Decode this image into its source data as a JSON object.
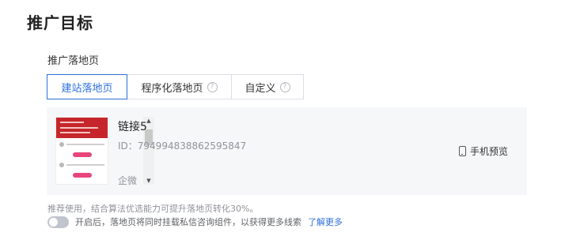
{
  "section": {
    "title": "推广目标"
  },
  "landing_page": {
    "label": "推广落地页",
    "tabs": [
      {
        "label": "建站落地页",
        "active": true,
        "has_help": false
      },
      {
        "label": "程序化落地页",
        "active": false,
        "has_help": true
      },
      {
        "label": "自定义",
        "active": false,
        "has_help": true
      }
    ],
    "card": {
      "name": "链接5",
      "id_text": "ID：794994838862595847",
      "type": "企微",
      "preview_label": "手机预览"
    },
    "hint": "推荐使用，结合算法优选能力可提升落地页转化30%。",
    "toggle": {
      "on": false,
      "label": "开启后，落地页将同时挂载私信咨询组件，以获得更多线索",
      "link": "了解更多"
    }
  },
  "colors": {
    "accent": "#2d6fe0",
    "muted_text": "#909399",
    "card_bg": "#f6f7f9",
    "thumb_banner": "#c6262b",
    "thumb_button": "#e8467b"
  },
  "icons": {
    "help": "question-circle-icon",
    "preview": "phone-icon",
    "scroll_up": "caret-up-icon",
    "scroll_down": "caret-down-icon"
  }
}
